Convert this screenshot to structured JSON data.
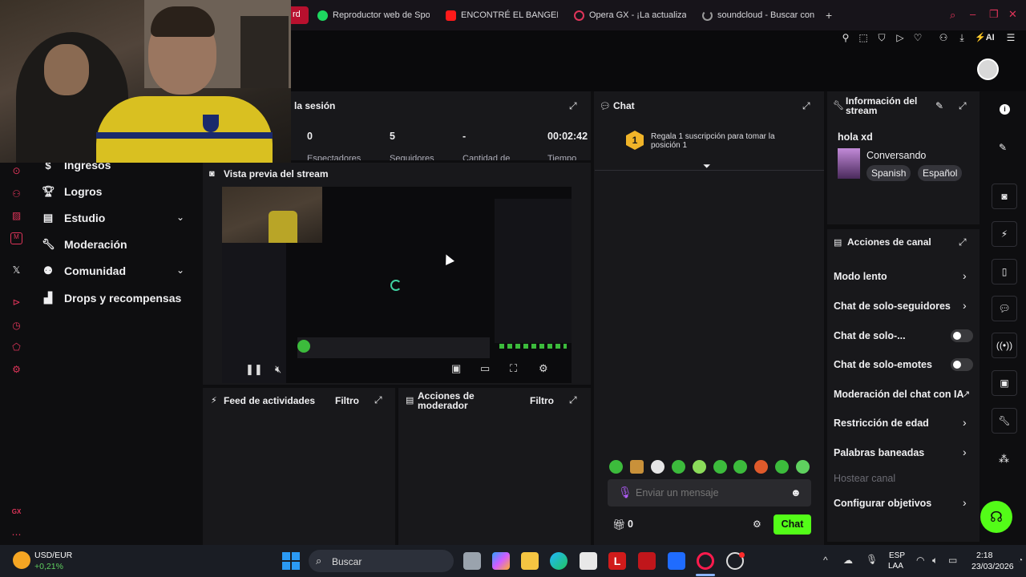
{
  "browser": {
    "tabs": [
      {
        "label": "rd",
        "icon": "twitch-icon"
      },
      {
        "label": "Reproductor web de Spoti",
        "icon": "spotify-icon"
      },
      {
        "label": "ENCONTRÉ EL BANGER D",
        "icon": "youtube-icon"
      },
      {
        "label": "Opera GX - ¡La actualiza",
        "icon": "opera-icon"
      },
      {
        "label": "soundcloud - Buscar con G",
        "icon": "loading-icon"
      }
    ],
    "new_tab": "+",
    "ai_label": "AI"
  },
  "session": {
    "title": "la sesión",
    "stats": [
      {
        "value": "0",
        "label": "Espectadores"
      },
      {
        "value": "5",
        "label": "Seguidores"
      },
      {
        "value": "-",
        "label": "Cantidad de"
      },
      {
        "value": "00:02:42",
        "label": "Tiempo"
      }
    ]
  },
  "chat": {
    "title": "Chat",
    "gift_rank": "1",
    "gift_text": "Regala 1 suscripción para tomar la posición 1",
    "input_placeholder": "Enviar un mensaje",
    "points": "0",
    "send_label": "Chat"
  },
  "stream_info": {
    "title": "Información del stream",
    "stream_title": "hola xd",
    "category": "Conversando",
    "tags": [
      "Spanish",
      "Español"
    ]
  },
  "channel_actions": {
    "title": "Acciones de canal",
    "items": [
      {
        "label": "Modo lento",
        "control": "arrow"
      },
      {
        "label": "Chat de solo-seguidores",
        "control": "arrow"
      },
      {
        "label": "Chat de solo-...",
        "control": "toggle",
        "on": false
      },
      {
        "label": "Chat de solo-emotes",
        "control": "toggle",
        "on": false
      },
      {
        "label": "Moderación del chat con IA",
        "control": "external"
      },
      {
        "label": "Restricción de edad",
        "control": "arrow"
      },
      {
        "label": "Palabras baneadas",
        "control": "arrow"
      },
      {
        "label": "Hostear canal",
        "control": "none",
        "disabled": true
      },
      {
        "label": "Configurar objetivos",
        "control": "arrow"
      }
    ]
  },
  "preview": {
    "title": "Vista previa del stream"
  },
  "activity": {
    "title": "Feed de actividades",
    "filter": "Filtro"
  },
  "mod_actions": {
    "title": "Acciones de moderador",
    "filter": "Filtro"
  },
  "nav": {
    "items": [
      {
        "label": "Ingresos",
        "icon": "dollar-icon"
      },
      {
        "label": "Logros",
        "icon": "trophy-icon"
      },
      {
        "label": "Estudio",
        "icon": "studio-icon",
        "expand": true
      },
      {
        "label": "Moderación",
        "icon": "wrench-icon"
      },
      {
        "label": "Comunidad",
        "icon": "community-icon",
        "expand": true
      },
      {
        "label": "Drops y recompensas",
        "icon": "drops-icon"
      }
    ]
  },
  "taskbar": {
    "ticker_name": "USD/EUR",
    "ticker_change": "+0,21%",
    "search_placeholder": "Buscar",
    "lang_top": "ESP",
    "lang_bottom": "LAA",
    "time": "2:18",
    "date": "23/03/2026"
  },
  "colors": {
    "accent": "#53fc18",
    "opera_red": "#e0355a",
    "bg": "#0e0e10",
    "panel": "#18181b"
  }
}
